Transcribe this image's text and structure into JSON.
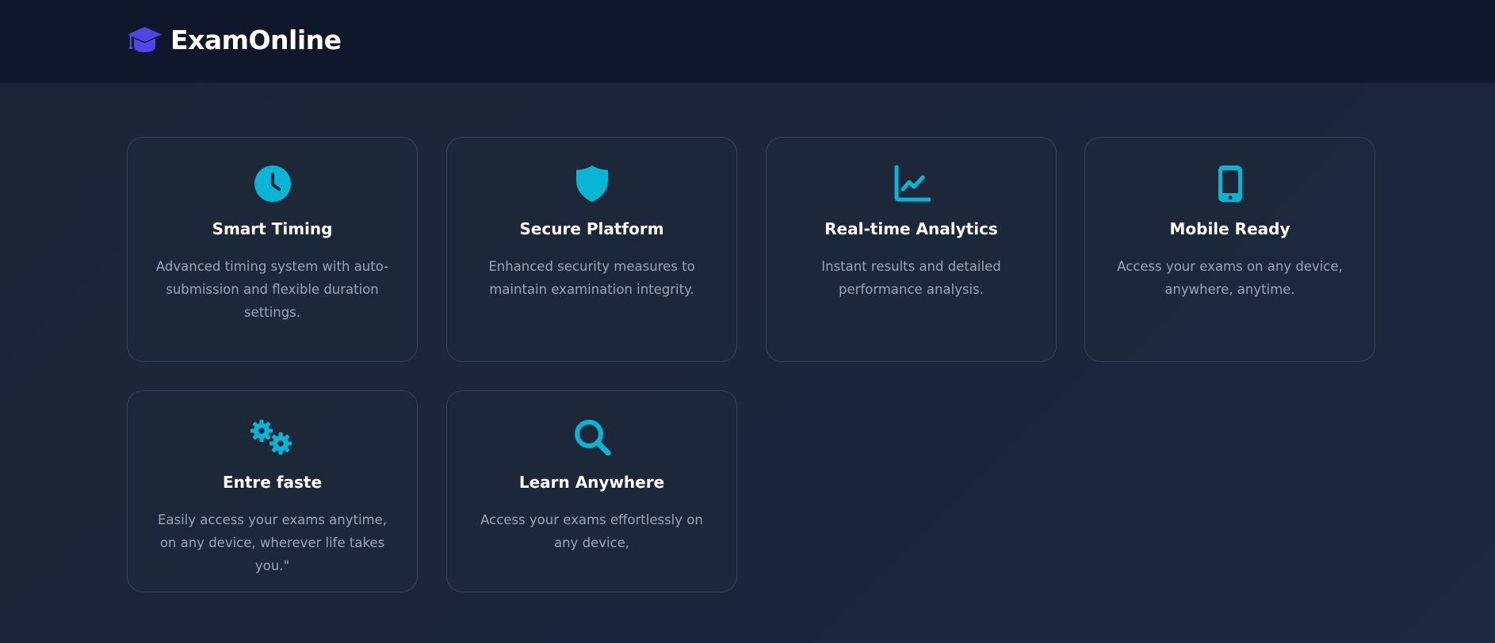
{
  "header": {
    "brand_name": "ExamOnline",
    "brand_icon": "graduation-cap-icon",
    "brand_icon_color": "#4f46e5"
  },
  "accent_color": "#06b6d4",
  "features": [
    {
      "title": "Smart Timing",
      "description": "Advanced timing system with auto-submission and flexible duration settings.",
      "icon": "clock-icon"
    },
    {
      "title": "Secure Platform",
      "description": "Enhanced security measures to maintain examination integrity.",
      "icon": "shield-icon"
    },
    {
      "title": "Real-time Analytics",
      "description": "Instant results and detailed performance analysis.",
      "icon": "chart-line-icon"
    },
    {
      "title": "Mobile Ready",
      "description": "Access your exams on any device, anywhere, anytime.",
      "icon": "mobile-phone-icon"
    },
    {
      "title": "Entre faste",
      "description": "Easily access your exams anytime, on any device, wherever life takes you.\"",
      "icon": "gears-icon"
    },
    {
      "title": "Learn Anywhere",
      "description": "Access your exams effortlessly on any device,",
      "icon": "search-icon"
    }
  ]
}
